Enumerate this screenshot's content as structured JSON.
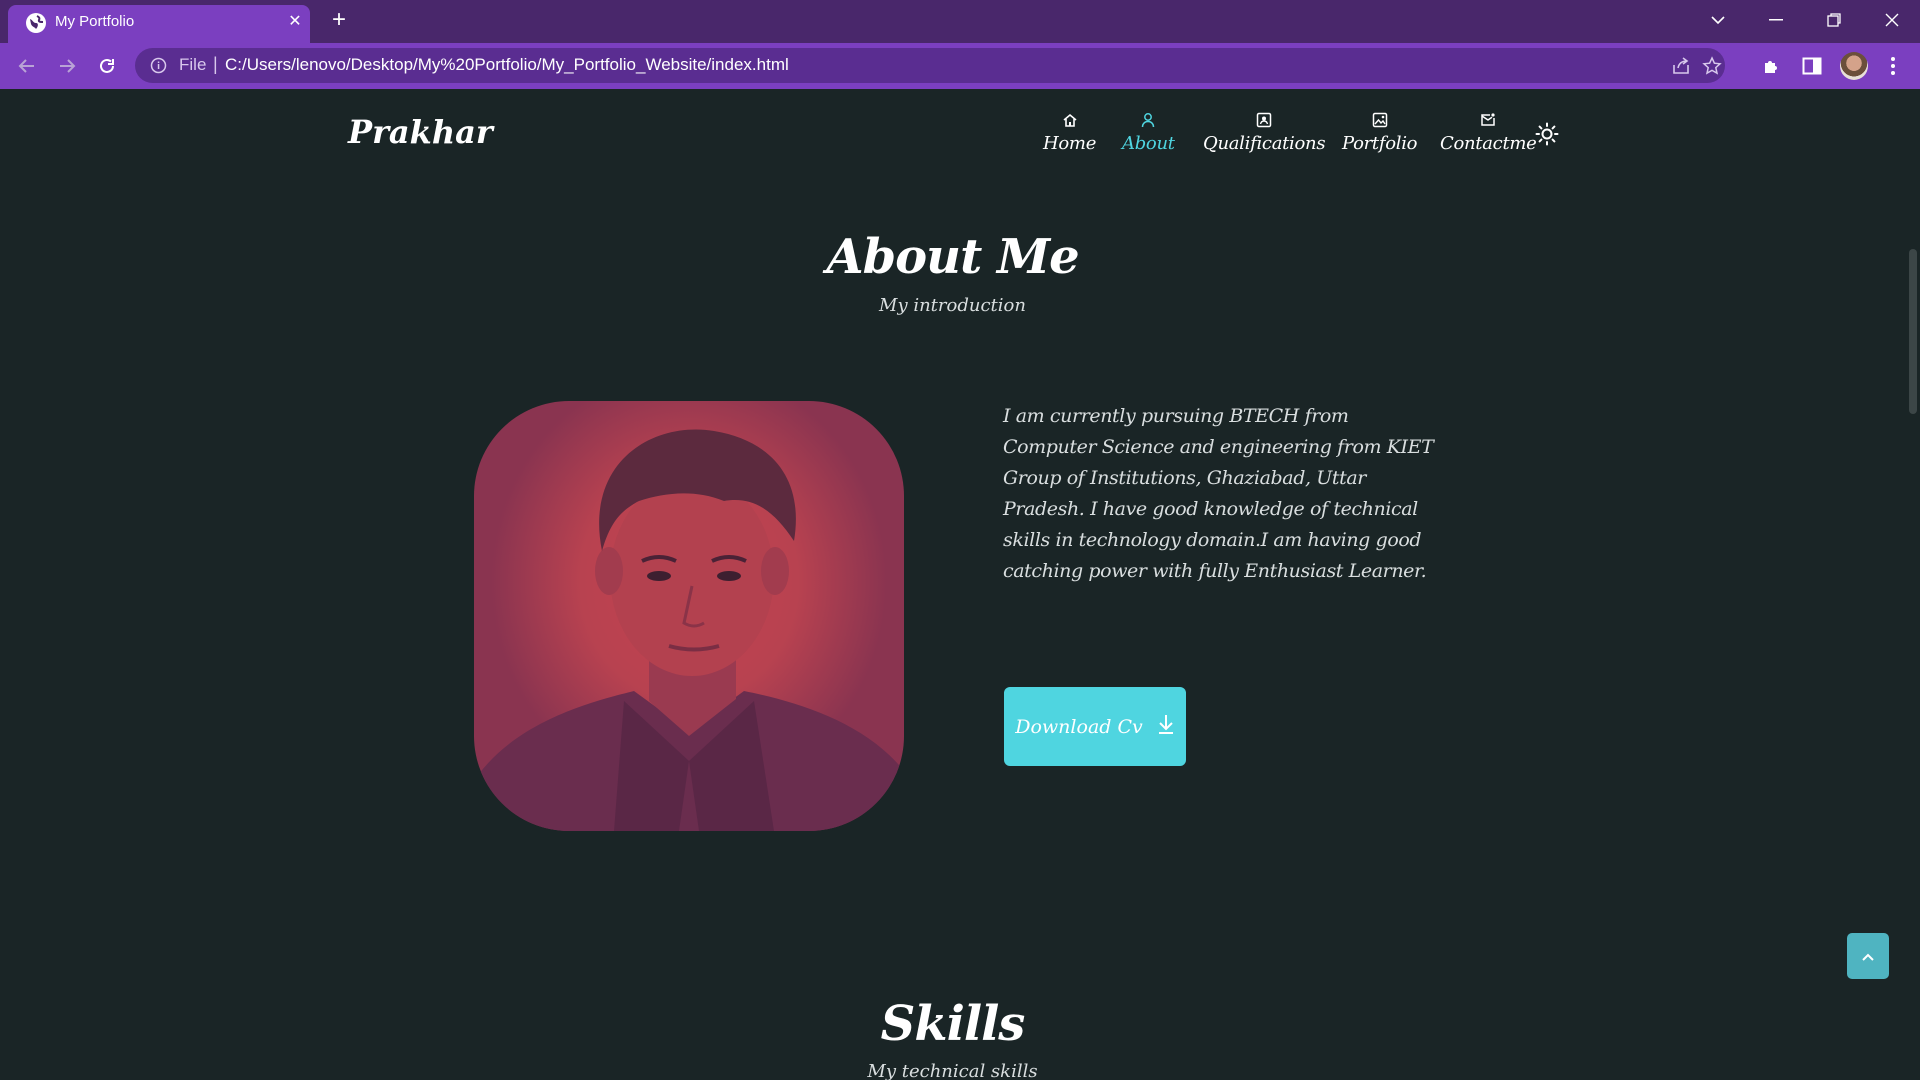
{
  "browser": {
    "tab_title": "My Portfolio",
    "tab_close": "✕",
    "new_tab": "+",
    "file_label": "File",
    "separator": "|",
    "url": "C:/Users/lenovo/Desktop/My%20Portfolio/My_Portfolio_Website/index.html"
  },
  "header": {
    "logo": "Prakhar",
    "nav": [
      {
        "label": "Home",
        "icon": "home-icon"
      },
      {
        "label": "About",
        "icon": "user-icon",
        "active": true
      },
      {
        "label": "Qualifications",
        "icon": "id-card-icon"
      },
      {
        "label": "Portfolio",
        "icon": "image-icon"
      },
      {
        "label": "Contactme",
        "icon": "mail-icon"
      }
    ],
    "theme_icon": "sun-icon"
  },
  "about": {
    "title": "About Me",
    "subtitle": "My introduction",
    "description": "I am currently pursuing BTECH from Computer Science and engineering from KIET Group of Institutions, Ghaziabad, Uttar Pradesh. I have good knowledge of technical skills in technology domain.I am having good catching power with fully Enthusiast Learner.",
    "download_label": "Download Cv"
  },
  "skills": {
    "title": "Skills",
    "subtitle": "My technical skills"
  },
  "colors": {
    "accent": "#4fd5e0",
    "background": "#1a2526",
    "photo_tint": "#c4444f",
    "browser_frame": "#7b3fc0"
  }
}
